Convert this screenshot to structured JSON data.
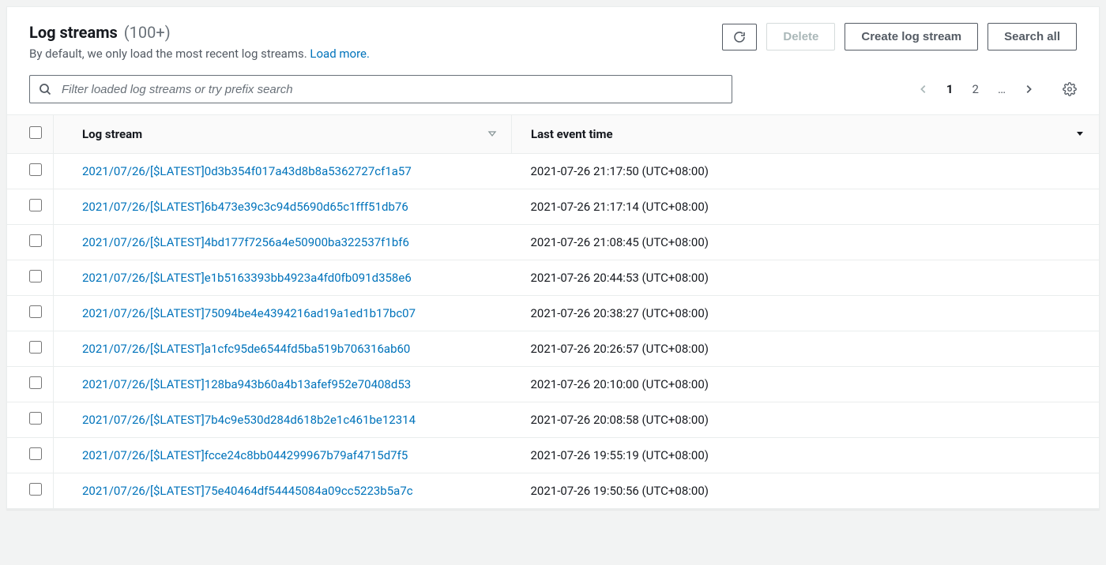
{
  "header": {
    "title": "Log streams",
    "count": "(100+)",
    "subtitle_prefix": "By default, we only load the most recent log streams. ",
    "load_more": "Load more."
  },
  "actions": {
    "refresh_aria": "Refresh",
    "delete": "Delete",
    "create": "Create log stream",
    "search_all": "Search all"
  },
  "search": {
    "placeholder": "Filter loaded log streams or try prefix search"
  },
  "pagination": {
    "page1": "1",
    "page2": "2",
    "ellipsis": "…"
  },
  "columns": {
    "log_stream": "Log stream",
    "last_event": "Last event time"
  },
  "rows": [
    {
      "name": "2021/07/26/[$LATEST]0d3b354f017a43d8b8a5362727cf1a57",
      "time": "2021-07-26 21:17:50 (UTC+08:00)"
    },
    {
      "name": "2021/07/26/[$LATEST]6b473e39c3c94d5690d65c1fff51db76",
      "time": "2021-07-26 21:17:14 (UTC+08:00)"
    },
    {
      "name": "2021/07/26/[$LATEST]4bd177f7256a4e50900ba322537f1bf6",
      "time": "2021-07-26 21:08:45 (UTC+08:00)"
    },
    {
      "name": "2021/07/26/[$LATEST]e1b5163393bb4923a4fd0fb091d358e6",
      "time": "2021-07-26 20:44:53 (UTC+08:00)"
    },
    {
      "name": "2021/07/26/[$LATEST]75094be4e4394216ad19a1ed1b17bc07",
      "time": "2021-07-26 20:38:27 (UTC+08:00)"
    },
    {
      "name": "2021/07/26/[$LATEST]a1cfc95de6544fd5ba519b706316ab60",
      "time": "2021-07-26 20:26:57 (UTC+08:00)"
    },
    {
      "name": "2021/07/26/[$LATEST]128ba943b60a4b13afef952e70408d53",
      "time": "2021-07-26 20:10:00 (UTC+08:00)"
    },
    {
      "name": "2021/07/26/[$LATEST]7b4c9e530d284d618b2e1c461be12314",
      "time": "2021-07-26 20:08:58 (UTC+08:00)"
    },
    {
      "name": "2021/07/26/[$LATEST]fcce24c8bb044299967b79af4715d7f5",
      "time": "2021-07-26 19:55:19 (UTC+08:00)"
    },
    {
      "name": "2021/07/26/[$LATEST]75e40464df54445084a09cc5223b5a7c",
      "time": "2021-07-26 19:50:56 (UTC+08:00)"
    }
  ]
}
